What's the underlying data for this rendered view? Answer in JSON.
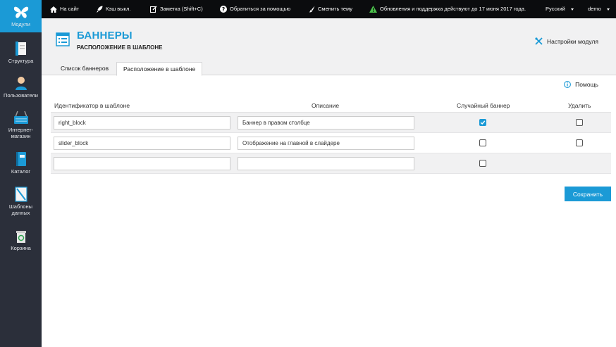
{
  "sidebar": {
    "items": [
      {
        "label": "Модули",
        "icon": "butterfly-icon"
      },
      {
        "label": "Структура",
        "icon": "structure-icon"
      },
      {
        "label": "Пользователи",
        "icon": "user-icon"
      },
      {
        "label_line1": "Интернет-",
        "label_line2": "магазин",
        "icon": "shop-basket-icon"
      },
      {
        "label": "Каталог",
        "icon": "catalog-book-icon"
      },
      {
        "label_line1": "Шаблоны",
        "label_line2": "данных",
        "icon": "data-template-icon"
      },
      {
        "label": "Корзина",
        "icon": "recycle-bin-icon"
      }
    ]
  },
  "topbar": {
    "site": "На сайт",
    "cache": "Кэш выкл.",
    "note": "Заметка (Shift+C)",
    "help": "Обратиться за помощью",
    "theme": "Сменить тему",
    "updates": "Обновления и поддержка действуют до 17 июня 2017 года.",
    "language": "Русский",
    "user": "demo"
  },
  "page": {
    "title": "БАННЕРЫ",
    "subtitle": "РАСПОЛОЖЕНИЕ В ШАБЛОНЕ",
    "settings": "Настройки модуля",
    "help": "Помощь"
  },
  "tabs": [
    {
      "label": "Список баннеров",
      "active": false
    },
    {
      "label": "Расположение в шаблоне",
      "active": true
    }
  ],
  "table": {
    "headers": {
      "id": "Идентификатор в шаблоне",
      "description": "Описание",
      "random": "Случайный баннер",
      "delete": "Удалить"
    },
    "rows": [
      {
        "id": "right_block",
        "description": "Баннер в правом столбце",
        "random": true,
        "delete": false
      },
      {
        "id": "slider_block",
        "description": "Отображение на главной в слайдере",
        "random": false,
        "delete": false
      },
      {
        "id": "",
        "description": "",
        "random": false
      }
    ]
  },
  "save_label": "Сохранить",
  "colors": {
    "accent": "#1b9ad6",
    "sidebar": "#2b2f3a",
    "topbar": "#0b0c0e"
  }
}
